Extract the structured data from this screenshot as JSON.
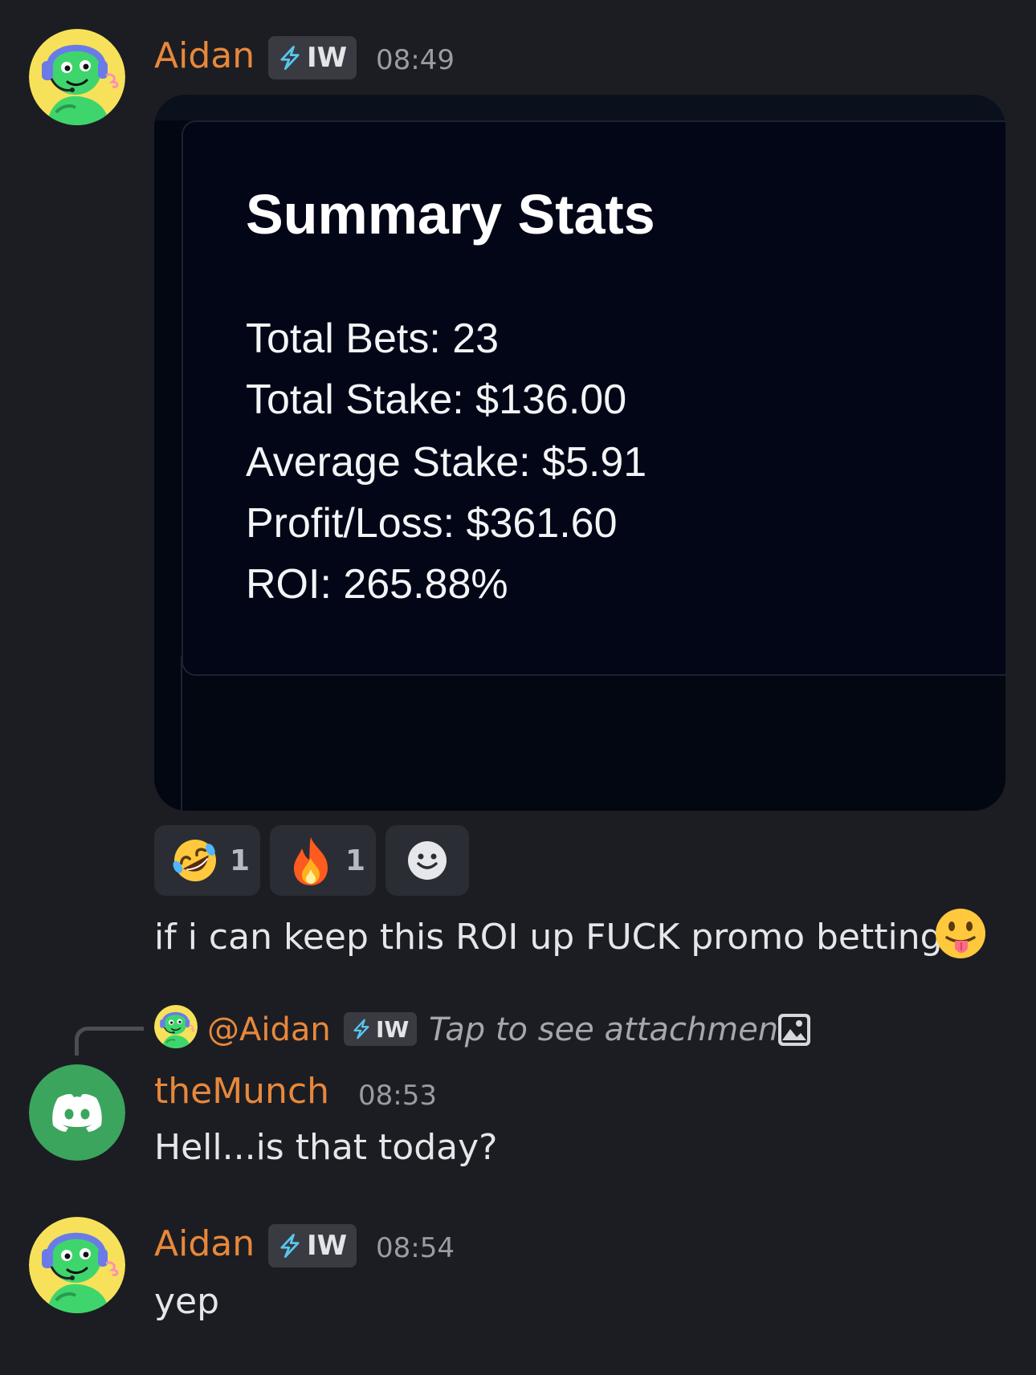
{
  "messages": [
    {
      "username": "Aidan",
      "tag": "IW",
      "time": "08:49",
      "attachment": {
        "title": "Summary Stats",
        "stats": [
          "Total Bets: 23",
          "Total Stake: $136.00",
          "Average Stake: $5.91",
          "Profit/Loss: $361.60",
          "ROI: 265.88%"
        ]
      },
      "reactions": [
        {
          "emoji": "rolling-on-floor-laughing-emoji",
          "count": "1"
        },
        {
          "emoji": "fire-emoji",
          "count": "1"
        },
        {
          "emoji": "add-reaction-icon",
          "count": ""
        }
      ],
      "text": "if i can keep this ROI up FUCK promo betting"
    },
    {
      "reply": {
        "mention": "@Aidan",
        "tag": "IW",
        "text": "Tap to see attachment"
      },
      "username": "theMunch",
      "time": "08:53",
      "text": "Hell...is that today?"
    },
    {
      "username": "Aidan",
      "tag": "IW",
      "time": "08:54",
      "text": "yep"
    }
  ],
  "colors": {
    "background": "#1c1d22",
    "username": "#e8883a",
    "timestamp": "#9a9ca4",
    "tag_background": "#3a3b42",
    "discord_green": "#3ba55d"
  }
}
